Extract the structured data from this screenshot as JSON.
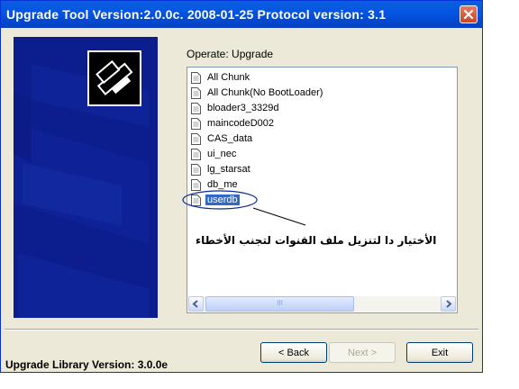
{
  "window": {
    "title": "Upgrade Tool Version:2.0.0c. 2008-01-25 Protocol version: 3.1",
    "close_icon": "close-x-icon"
  },
  "banner": {
    "icon": "printer-icon",
    "bg_color": "#0c1d8e"
  },
  "operate": {
    "label": "Operate: Upgrade"
  },
  "file_list": {
    "items": [
      {
        "label": "All Chunk",
        "selected": false
      },
      {
        "label": "All Chunk(No BootLoader)",
        "selected": false
      },
      {
        "label": "bloader3_3329d",
        "selected": false
      },
      {
        "label": "maincodeD002",
        "selected": false
      },
      {
        "label": "CAS_data",
        "selected": false
      },
      {
        "label": "ui_nec",
        "selected": false
      },
      {
        "label": "lg_starsat",
        "selected": false
      },
      {
        "label": "db_me",
        "selected": false
      },
      {
        "label": "userdb",
        "selected": true
      }
    ],
    "item_icon": "document-icon",
    "selected_color": "#316ac5"
  },
  "annotation": {
    "text": "الأختيار دا لتنزيل ملف القنوات لتجنب الأخطاء"
  },
  "scroll": {
    "left_icon": "arrow-left-icon",
    "right_icon": "arrow-right-icon",
    "grip": "III"
  },
  "buttons": {
    "back": "< Back",
    "next": "Next >",
    "exit": "Exit"
  },
  "footer": {
    "library_version": "Upgrade Library Version: 3.0.0e"
  },
  "colors": {
    "title_bar": "#0454e2",
    "window_bg": "#ece9d8",
    "annotation_ellipse": "#0a2a9a"
  }
}
